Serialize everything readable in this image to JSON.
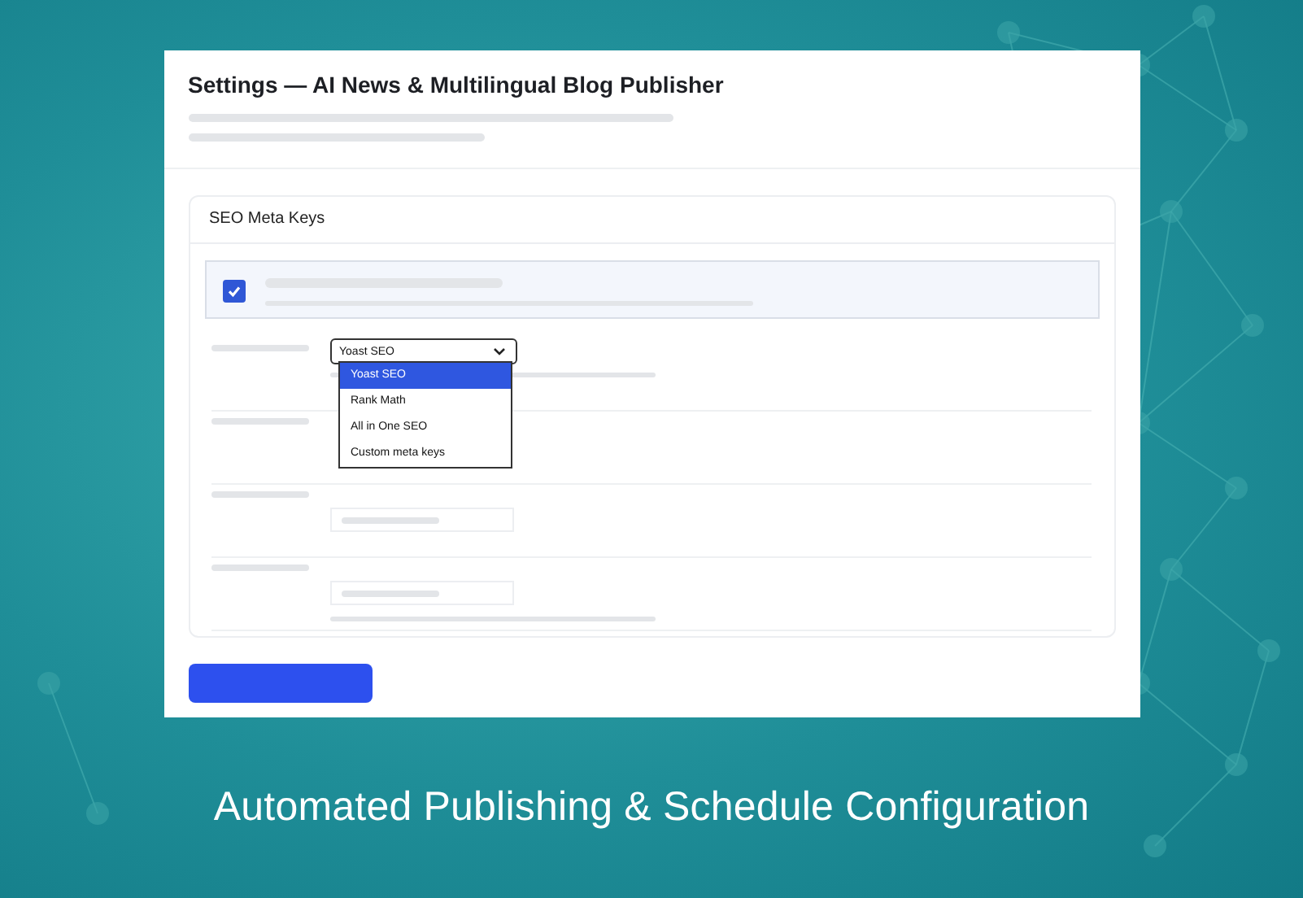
{
  "window": {
    "title": "Settings — AI News & Multilingual Blog Publisher"
  },
  "section": {
    "title": "SEO Meta Keys",
    "checkbox": {
      "checked": true
    },
    "select": {
      "value": "Yoast SEO",
      "expanded": true,
      "options": [
        {
          "label": "Yoast SEO",
          "selected": true
        },
        {
          "label": "Rank Math",
          "selected": false
        },
        {
          "label": "All in One SEO",
          "selected": false
        },
        {
          "label": "Custom meta keys",
          "selected": false
        }
      ]
    }
  },
  "caption": "Automated Publishing & Schedule Configuration"
}
